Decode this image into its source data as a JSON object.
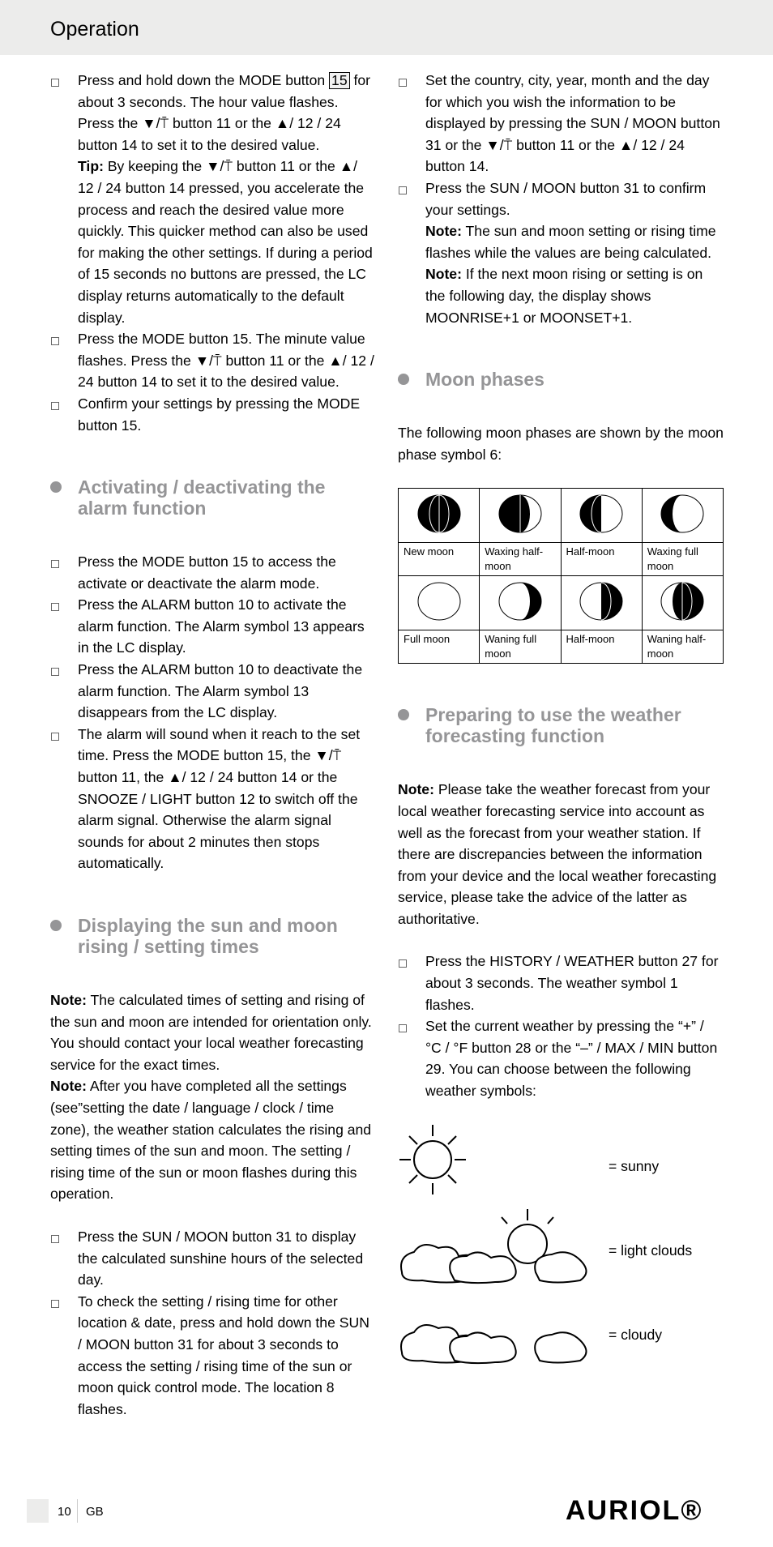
{
  "header": {
    "title": "Operation"
  },
  "left": {
    "items1": [
      {
        "t": "Press and hold down the MODE button ",
        "n": "15",
        "r": " for about 3 seconds. The hour value flashes. Press the ▼/⍑ button 11 or the ▲/ 12 / 24 button 14 to set it to the desired value."
      },
      {
        "tip_label": "Tip:",
        "tip": " By keeping the ▼/⍑ button 11 or the ▲/ 12 / 24 button 14 pressed, you accelerate the process and reach the desired value more quickly. This quicker method can also be used for making the other settings. If during a period of 15 seconds no buttons are pressed, the LC display returns automatically to the default display."
      },
      {
        "t": "Press the MODE button 15. The minute value flashes. Press the ▼/⍑ button 11 or the ▲/ 12 / 24 button 14 to set it to the desired value."
      },
      {
        "t": "Confirm your settings by pressing the MODE button 15."
      }
    ],
    "h_alarm": "Activating / deactivating the alarm function",
    "alarm": [
      "Press the MODE button 15 to access the activate or deactivate the alarm mode.",
      "Press the ALARM button 10 to activate the alarm function. The Alarm symbol 13 appears in the LC display.",
      "Press the ALARM button 10 to deactivate the alarm function. The Alarm symbol 13 disappears from the LC display.",
      "The alarm will sound when it reach to the set time. Press the MODE button 15, the ▼/⍑ button 11, the ▲/ 12 / 24 button 14 or the SNOOZE / LIGHT button 12 to switch off the alarm signal. Otherwise the alarm signal sounds for about 2 minutes then stops automatically."
    ],
    "h_sun": "Displaying the sun and moon rising / setting times",
    "note_label": "Note:",
    "note1": " The calculated times of setting and rising of the sun and moon are intended for orientation only. You should contact your local weather forecasting service for the exact times.",
    "note2": " After you have completed all the settings (see”setting the date / language / clock / time zone), the weather station calculates the rising and setting times of the sun and moon. The setting / rising time of the sun or moon flashes during this operation.",
    "sun": [
      "Press the SUN / MOON button 31 to display the calculated sunshine hours of the selected day.",
      "To check the setting / rising time for other location & date, press and hold down the SUN / MOON button 31 for about 3 seconds to access the setting / rising time of the sun or moon quick control mode. The location 8 flashes."
    ]
  },
  "right": {
    "items": [
      "Set the country, city, year, month and the day for which you wish the information to be displayed by pressing the SUN / MOON button 31 or the ▼/⍑ button 11 or the ▲/ 12 / 24 button 14.",
      "Press the SUN / MOON button 31 to confirm your settings."
    ],
    "note_label": "Note:",
    "note1": " The sun and moon setting or rising time flashes while the values are being calculated.",
    "note2": " If the next moon rising or setting is on the following day, the display shows MOONRISE+1 or MOONSET+1.",
    "h_moon": "Moon phases",
    "moon_intro": "The following moon phases are shown by the moon phase symbol 6:",
    "phases": [
      "New moon",
      "Waxing half-moon",
      "Half-moon",
      "Waxing full moon",
      "Full moon",
      "Waning full moon",
      "Half-moon",
      "Waning half-moon"
    ],
    "h_weather": "Preparing to use the weather forecasting function",
    "w_note": " Please take the weather forecast from your local weather forecasting service into account as well as the forecast from your weather station. If there are discrepancies between the information from your device and the local weather forecasting service, please take the advice of the latter as authoritative.",
    "w_items": [
      "Press the HISTORY / WEATHER button 27 for about 3 seconds. The weather symbol 1 flashes.",
      "Set the current weather by pressing the “+” / °C / °F button 28 or the “–” / MAX / MIN button 29. You can choose between the following weather symbols:"
    ],
    "symbols": [
      "=   sunny",
      "=   light clouds",
      "=   cloudy"
    ]
  },
  "footer": {
    "page": "10",
    "lang": "GB",
    "brand": "AURIOL®"
  }
}
